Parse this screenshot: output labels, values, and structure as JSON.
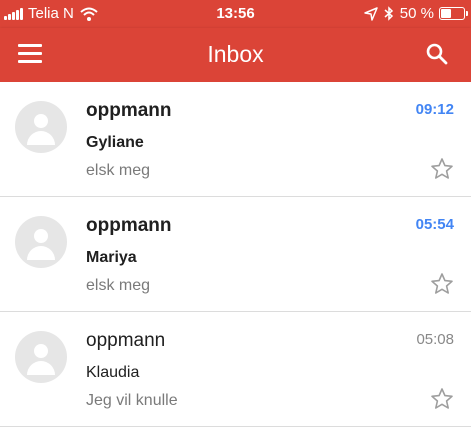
{
  "status_bar": {
    "carrier": "Telia N",
    "time": "13:56",
    "battery": "50 %",
    "battery_level": 0.5
  },
  "app_bar": {
    "title": "Inbox",
    "menu_icon": "hamburger-menu-icon",
    "search_icon": "search-icon"
  },
  "colors": {
    "brand": "#db4437",
    "unread_time": "#4285f4"
  },
  "messages": [
    {
      "sender": "oppmann",
      "subject": "Gyliane",
      "snippet": "elsk meg",
      "time": "09:12",
      "unread": true,
      "starred": false
    },
    {
      "sender": "oppmann",
      "subject": "Mariya",
      "snippet": "elsk meg",
      "time": "05:54",
      "unread": true,
      "starred": false
    },
    {
      "sender": "oppmann",
      "subject": "Klaudia",
      "snippet": "Jeg vil knulle",
      "time": "05:08",
      "unread": false,
      "starred": false
    }
  ]
}
